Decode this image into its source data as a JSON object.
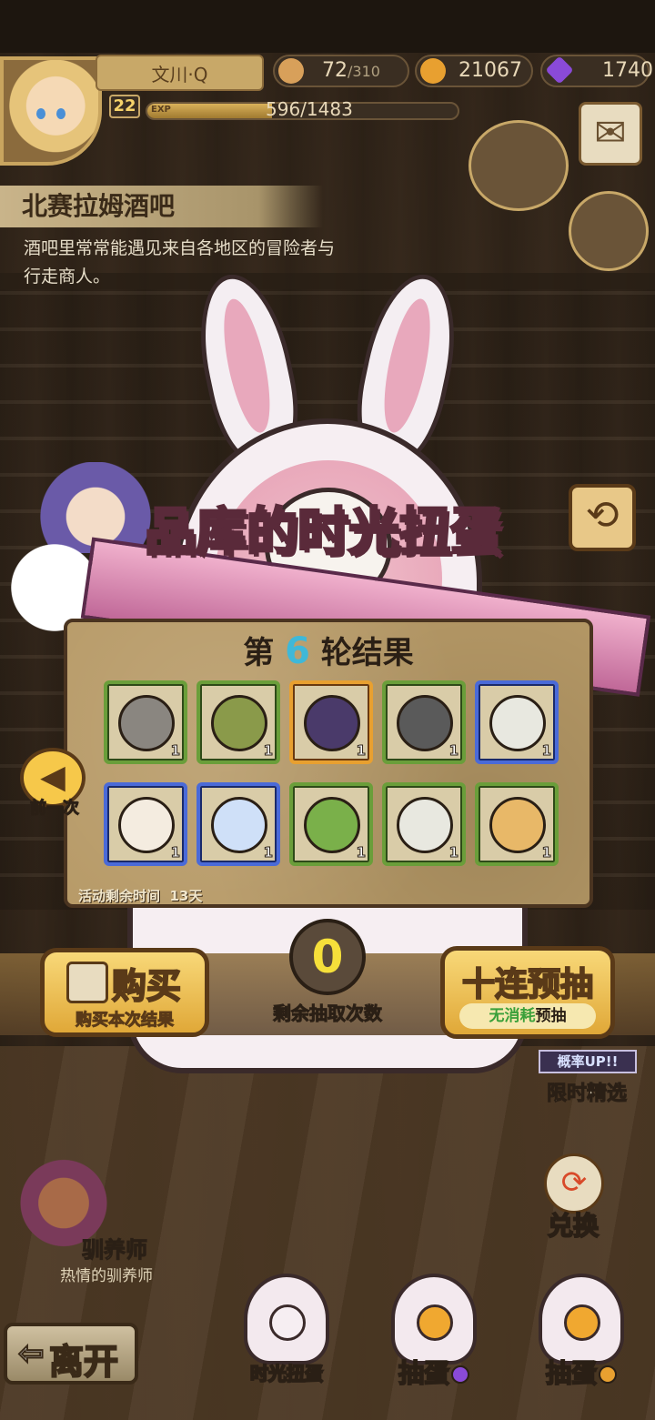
{
  "header": {
    "player_name": "文川·Q",
    "level": "22",
    "exp_label": "EXP",
    "exp_text": "596/1483",
    "exp_fraction": 0.402,
    "stamina": {
      "value": "72",
      "max": "/310",
      "icon": "bread-icon"
    },
    "gold": {
      "value": "21067",
      "icon": "gold-coin-icon",
      "color": "#e8a030"
    },
    "gems": {
      "value": "1740",
      "icon": "purple-gem-icon",
      "color": "#8a4ad8"
    }
  },
  "location": {
    "title": "北赛拉姆酒吧",
    "description": "酒吧里常常能遇见来自各地区的冒险者与行走商人。"
  },
  "banner": {
    "title_part1": "品库的",
    "title_highlight": "时光",
    "title_part2": "扭蛋"
  },
  "results": {
    "round_prefix": "第",
    "round_number": "6",
    "round_suffix": "轮结果",
    "items": [
      {
        "name": "gray-hair-item",
        "qty": "1",
        "rarity": "green",
        "color": "#8a8680"
      },
      {
        "name": "green-egg-item",
        "qty": "1",
        "rarity": "green",
        "color": "#8a9a4a"
      },
      {
        "name": "dark-character-item",
        "qty": "1",
        "rarity": "gold",
        "color": "#4a3a6a"
      },
      {
        "name": "gray-hat-item",
        "qty": "1",
        "rarity": "green",
        "color": "#5a5a5a"
      },
      {
        "name": "spotted-egg-item",
        "qty": "1",
        "rarity": "blue",
        "color": "#e8e8e0"
      },
      {
        "name": "fluffy-egg-item",
        "qty": "1",
        "rarity": "blue",
        "color": "#f4ece0"
      },
      {
        "name": "cloud-mount-item",
        "qty": "1",
        "rarity": "blue",
        "color": "#cfe0f8"
      },
      {
        "name": "cactus-item",
        "qty": "1",
        "rarity": "green",
        "color": "#7ab04a"
      },
      {
        "name": "spotted-egg-item-2",
        "qty": "1",
        "rarity": "green",
        "color": "#e8e8e0"
      },
      {
        "name": "golden-egg-item",
        "qty": "1",
        "rarity": "green",
        "color": "#e8b868"
      }
    ],
    "timer_label": "活动剩余时间",
    "timer_value": "13天"
  },
  "controls": {
    "prev_label": "前一次",
    "buy_title": "购买",
    "buy_sub": "购买本次结果",
    "draws_count": "0",
    "draws_label": "剩余抽取次数",
    "ten_title": "十连预抽",
    "ten_sub_green": "无消耗",
    "ten_sub_rest": "预抽"
  },
  "side": {
    "limited_tag": "概率UP!!",
    "limited_label": "限时精选",
    "exchange_label": "兑换",
    "tamer_name": "驯养师",
    "tamer_sub": "热情的驯养师"
  },
  "nav": {
    "leave_label": "离开",
    "time_gacha_label": "时光扭蛋",
    "gacha_gem_label": "抽蛋",
    "gacha_gold_label": "抽蛋"
  }
}
